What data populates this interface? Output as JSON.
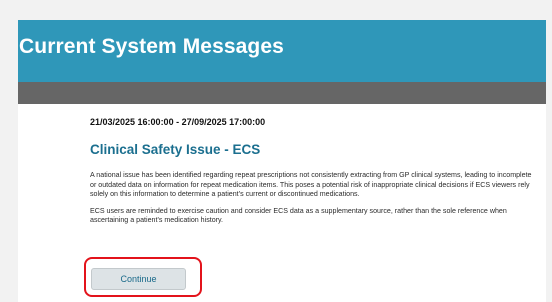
{
  "header": {
    "title": "Current System Messages"
  },
  "message": {
    "date_range": "21/03/2025 16:00:00 - 27/09/2025 17:00:00",
    "title": "Clinical Safety Issue - ECS",
    "paragraphs": [
      "A national issue has been identified regarding repeat prescriptions not consistently extracting from GP clinical systems, leading to incomplete or outdated data on information for repeat medication items.  This poses a potential risk of inappropriate clinical decisions if ECS viewers rely solely on this information to determine a patient’s current or discontinued medications.",
      "ECS users are reminded to exercise caution and consider ECS data as a supplementary source, rather than the sole reference when ascertaining a patient’s medication history."
    ]
  },
  "actions": {
    "continue_label": "Continue"
  },
  "colors": {
    "header_bg": "#2f97b9",
    "bar_grey": "#666666",
    "title_color": "#1b6f8f",
    "highlight_red": "#e3131b",
    "button_bg": "#dde3e6"
  }
}
